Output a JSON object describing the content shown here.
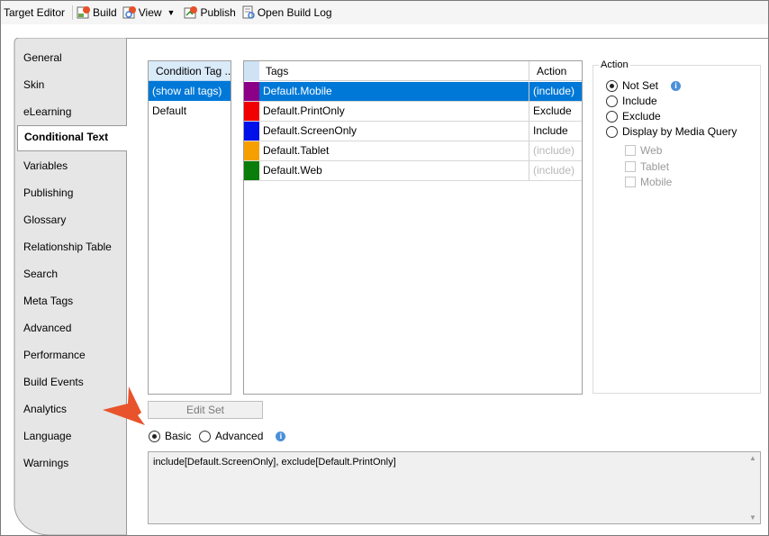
{
  "toolbar": {
    "title": "Target Editor",
    "build": "Build",
    "view": "View",
    "publish": "Publish",
    "open_build_log": "Open Build Log"
  },
  "sidebar": {
    "items": [
      "General",
      "Skin",
      "eLearning",
      "Conditional Text",
      "Variables",
      "Publishing",
      "Glossary",
      "Relationship Table",
      "Search",
      "Meta Tags",
      "Advanced",
      "Performance",
      "Build Events",
      "Analytics",
      "Language",
      "Warnings"
    ],
    "active": "Conditional Text"
  },
  "sets": {
    "header": "Condition Tag ...",
    "rows": [
      "(show all tags)",
      "Default"
    ]
  },
  "tags": {
    "header_tags": "Tags",
    "header_action": "Action",
    "rows": [
      {
        "name": "Default.Mobile",
        "action": "(include)",
        "color": "#8b0087"
      },
      {
        "name": "Default.PrintOnly",
        "action": "Exclude",
        "color": "#f00000"
      },
      {
        "name": "Default.ScreenOnly",
        "action": "Include",
        "color": "#0010e8"
      },
      {
        "name": "Default.Tablet",
        "action": "(include)",
        "color": "#f5a000"
      },
      {
        "name": "Default.Web",
        "action": "(include)",
        "color": "#0a7d0a"
      }
    ]
  },
  "action": {
    "legend": "Action",
    "options": [
      "Not Set",
      "Include",
      "Exclude",
      "Display by Media Query"
    ],
    "media": [
      "Web",
      "Tablet",
      "Mobile"
    ]
  },
  "edit_set": "Edit Set",
  "mode": {
    "basic": "Basic",
    "advanced": "Advanced"
  },
  "expression": "include[Default.ScreenOnly], exclude[Default.PrintOnly]"
}
